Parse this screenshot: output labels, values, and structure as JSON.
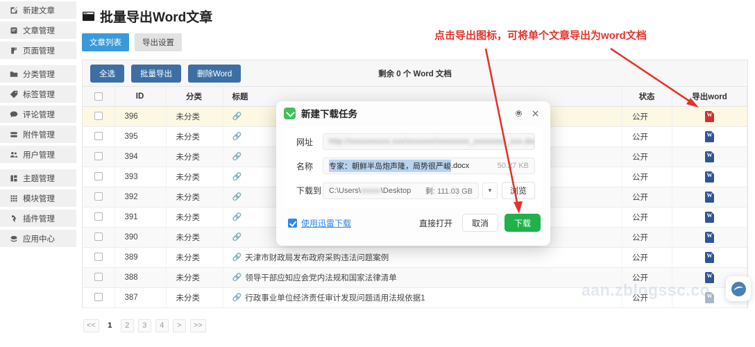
{
  "sidebar": {
    "items": [
      {
        "label": "新建文章",
        "icon": "edit-square-icon"
      },
      {
        "label": "文章管理",
        "icon": "article-icon"
      },
      {
        "label": "页面管理",
        "icon": "page-icon"
      },
      {
        "label": "分类管理",
        "icon": "folder-icon"
      },
      {
        "label": "标签管理",
        "icon": "tag-icon"
      },
      {
        "label": "评论管理",
        "icon": "comment-icon"
      },
      {
        "label": "附件管理",
        "icon": "attachment-icon"
      },
      {
        "label": "用户管理",
        "icon": "users-icon"
      },
      {
        "label": "主题管理",
        "icon": "theme-icon"
      },
      {
        "label": "模块管理",
        "icon": "grid-icon"
      },
      {
        "label": "插件管理",
        "icon": "puzzle-icon"
      },
      {
        "label": "应用中心",
        "icon": "app-center-icon"
      }
    ]
  },
  "header": {
    "title": "批量导出Word文章",
    "title_icon": "window-icon",
    "tabs": [
      {
        "label": "文章列表",
        "active": true
      },
      {
        "label": "导出设置",
        "active": false
      }
    ]
  },
  "toolbar": {
    "select_all_label": "全选",
    "batch_export_label": "批量导出",
    "delete_word_label": "删除Word",
    "remaining_text": "剩余 0 个 Word 文档"
  },
  "table": {
    "columns": [
      "",
      "ID",
      "分类",
      "标题",
      "状态",
      "导出word"
    ],
    "rows": [
      {
        "id": "396",
        "category": "未分类",
        "title": "",
        "status": "公开",
        "export_icon": "word-doc-icon-red",
        "highlight": true,
        "title_hidden": true
      },
      {
        "id": "395",
        "category": "未分类",
        "title": "",
        "status": "公开",
        "export_icon": "word-doc-icon",
        "highlight": false,
        "title_hidden": true
      },
      {
        "id": "394",
        "category": "未分类",
        "title": "",
        "status": "公开",
        "export_icon": "word-doc-icon",
        "highlight": false,
        "title_hidden": true
      },
      {
        "id": "393",
        "category": "未分类",
        "title": "",
        "status": "公开",
        "export_icon": "word-doc-icon",
        "highlight": false,
        "title_hidden": true
      },
      {
        "id": "392",
        "category": "未分类",
        "title": "",
        "status": "公开",
        "export_icon": "word-doc-icon",
        "highlight": false,
        "title_hidden": true
      },
      {
        "id": "391",
        "category": "未分类",
        "title": "",
        "status": "公开",
        "export_icon": "word-doc-icon",
        "highlight": false,
        "title_hidden": true
      },
      {
        "id": "390",
        "category": "未分类",
        "title": "",
        "status": "公开",
        "export_icon": "word-doc-icon",
        "highlight": false,
        "title_hidden": true
      },
      {
        "id": "389",
        "category": "未分类",
        "title": "天津市财政局发布政府采购违法问题案例",
        "status": "公开",
        "export_icon": "word-doc-icon",
        "highlight": false,
        "title_hidden": false
      },
      {
        "id": "388",
        "category": "未分类",
        "title": "领导干部应知应会党内法规和国家法律清单",
        "status": "公开",
        "export_icon": "word-doc-icon",
        "highlight": false,
        "title_hidden": false
      },
      {
        "id": "387",
        "category": "未分类",
        "title": "行政事业单位经济责任审计发现问题适用法规依据1",
        "status": "公开",
        "export_icon": "word-doc-icon-pale",
        "highlight": false,
        "title_hidden": false
      }
    ]
  },
  "pagination": {
    "items": [
      {
        "label": "<<",
        "current": false
      },
      {
        "label": "1",
        "current": true
      },
      {
        "label": "2",
        "current": false
      },
      {
        "label": "3",
        "current": false
      },
      {
        "label": "4",
        "current": false
      },
      {
        "label": ">",
        "current": false
      },
      {
        "label": ">>",
        "current": false
      }
    ]
  },
  "dialog": {
    "title": "新建下载任务",
    "logo_icon": "thunder-download-icon",
    "settings_icon": "gear-icon",
    "close_icon": "close-icon",
    "url_label": "网址",
    "url_value": "http://xxxxxxxxxx.xxx/xxxxxxx/xxxxxxxx_xxxxxxxx_xxx.docx",
    "name_label": "名称",
    "name_value_selected": "专家：朝鲜半岛炮声隆，局势很严峻",
    "name_value_ext": ".docx",
    "file_size": "50.27 KB",
    "path_label": "下载到",
    "path_value_prefix": "C:\\Users\\",
    "path_value_blur": "xxxxx",
    "path_value_suffix": "\\Desktop",
    "free_space": "剩: 111.03 GB",
    "dropdown_icon": "chevron-down-icon",
    "browse_label": "浏览",
    "thunder_label": "使用迅雷下载",
    "open_directly_label": "直接打开",
    "cancel_label": "取消",
    "download_label": "下载"
  },
  "annotations": {
    "note_text": "点击导出图标，可将单个文章导出为word文档",
    "note_color": "#e2342a"
  },
  "watermark": {
    "text": "aan.zblogssc.co"
  },
  "fab": {
    "icon": "assistant-icon"
  }
}
